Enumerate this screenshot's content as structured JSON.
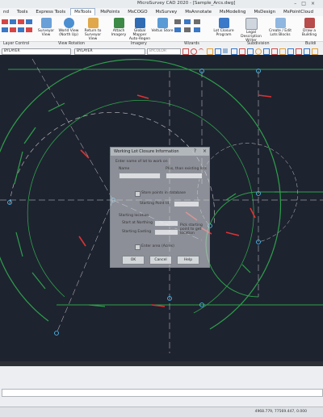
{
  "window": {
    "title": "MicroSurvey CAD 2020 - [Sample_Arcs.dwg]"
  },
  "tabs": [
    "nd",
    "Tools",
    "Express Tools",
    "MsTools",
    "MsPoints",
    "MsCOGO",
    "MsSurvey",
    "MsAnnotate",
    "MsModeling",
    "MsDesign",
    "MsPointCloud"
  ],
  "active_tab": "MsTools",
  "ribbon": {
    "buttons": [
      {
        "label": "Surveyor View"
      },
      {
        "label": "World View (North Up)"
      },
      {
        "label": "Return to Surveyor View"
      },
      {
        "label": "Attach Imagery"
      },
      {
        "label": "Global Mapper Auto-Regen"
      },
      {
        "label": "Veltus Store"
      },
      {
        "label": "Lot Closure Program"
      },
      {
        "label": "Legal Description Writer"
      },
      {
        "label": "Create / Edit Lots Blocks"
      },
      {
        "label": "Draw a Building"
      }
    ],
    "groups": [
      "Layer Control",
      "View Rotation",
      "Imagery",
      "Wizards",
      "Subdivision",
      "Buildi"
    ]
  },
  "options_bar": {
    "layer_combo": "BYLAYER",
    "linetype_combo": "BYLAYER",
    "lineweight_combo": "BYCOLOR"
  },
  "dialog": {
    "title": "Working Lot Closure Information",
    "help_glyph": "?",
    "close_glyph": "×",
    "prompt": "Enter name of lot to work on",
    "name_label": "Name",
    "plus_label": "Plus, than existing lots",
    "store_points_label": "Store points in database",
    "starting_point_label": "Starting Point Id",
    "starting_location_label": "Starting location",
    "northing_label": "Start at Northing",
    "easting_label": "Starting Easting",
    "pick_label": "Pick starting point to get location",
    "enter_area_label": "Enter area (Acres)",
    "buttons": [
      "OK",
      "Cancel",
      "Help"
    ]
  },
  "status": {
    "coords": "4968.779, 77569.447, 0.000"
  }
}
